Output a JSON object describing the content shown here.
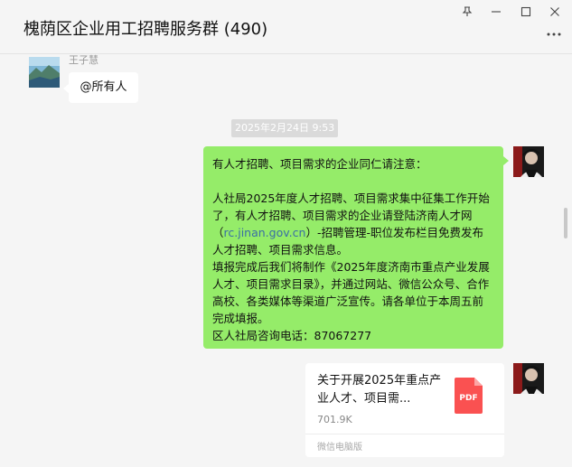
{
  "window": {
    "title": "槐荫区企业用工招聘服务群 (490)",
    "controls": [
      "pin-icon",
      "minimize-icon",
      "maximize-icon",
      "close-icon"
    ]
  },
  "messages": {
    "first": {
      "sender": "王子慧",
      "text": "@所有人"
    },
    "timestamp": "2025年2月24日 9:53",
    "notice": {
      "line1": "有人才招聘、项目需求的企业同仁请注意：",
      "para1_a": "人社局2025年度人才招聘、项目需求集中征集工作开始了，有人才招聘、项目需求的企业请登陆济南人才网（",
      "link": "rc.jinan.gov.cn",
      "para1_b": "）-招聘管理-职位发布栏目免费发布人才招聘、项目需求信息。",
      "para2": "填报完成后我们将制作《2025年度济南市重点产业发展人才、项目需求目录》，并通过网站、微信公众号、合作高校、各类媒体等渠道广泛宣传。请各单位于本周五前完成填报。",
      "para3": "区人社局咨询电话：87067277"
    },
    "file": {
      "title": "关于开展2025年重点产业人才、项目需...",
      "type_label": "PDF",
      "size": "701.9K",
      "source": "微信电脑版"
    }
  },
  "colors": {
    "background": "#f5f5f5",
    "bubble_self": "#95ec69",
    "bubble_other": "#ffffff",
    "link": "#3a6ea5",
    "pdf_red": "#fa5151"
  }
}
